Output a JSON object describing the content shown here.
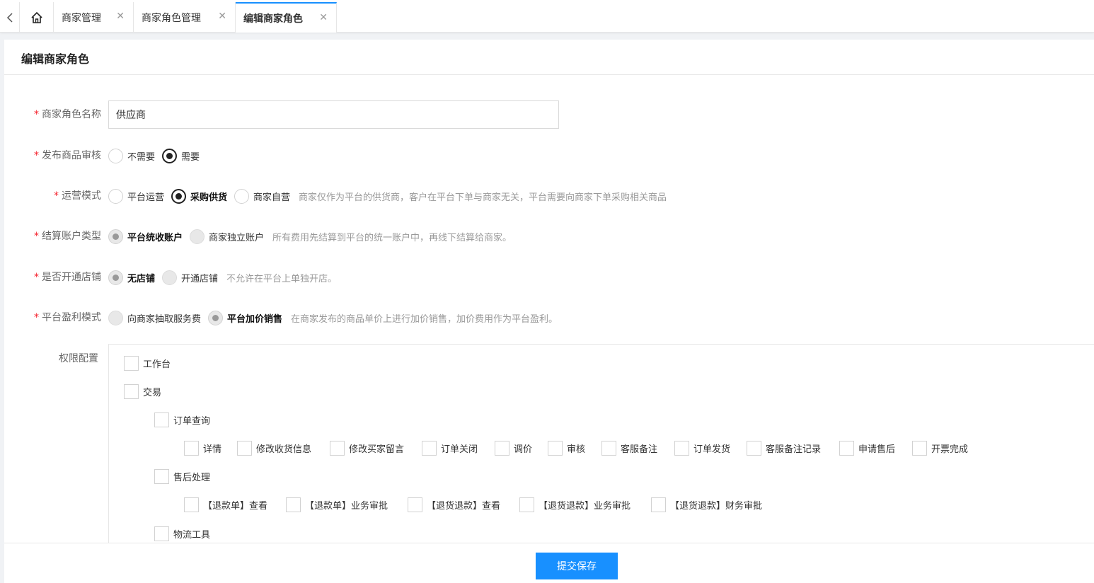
{
  "tabs": {
    "back_icon": "chevron-left-icon",
    "home_icon": "home-icon",
    "items": [
      {
        "label": "商家管理"
      },
      {
        "label": "商家角色管理"
      },
      {
        "label": "编辑商家角色"
      }
    ],
    "close_glyph": "✕"
  },
  "page": {
    "title": "编辑商家角色"
  },
  "form": {
    "required_mark": "*",
    "role_name": {
      "label": "商家角色名称",
      "value": "供应商"
    },
    "review": {
      "label": "发布商品审核",
      "options": [
        "不需要",
        "需要"
      ],
      "selected": "需要"
    },
    "operation": {
      "label": "运营模式",
      "options": [
        "平台运营",
        "采购供货",
        "商家自营"
      ],
      "selected": "采购供货",
      "hint": "商家仅作为平台的供货商，客户在平台下单与商家无关，平台需要向商家下单采购相关商品"
    },
    "settlement": {
      "label": "结算账户类型",
      "options": [
        "平台统收账户",
        "商家独立账户"
      ],
      "selected": "平台统收账户",
      "hint": "所有费用先结算到平台的统一账户中，再线下结算给商家。"
    },
    "store": {
      "label": "是否开通店铺",
      "options": [
        "无店铺",
        "开通店铺"
      ],
      "selected": "无店铺",
      "hint": "不允许在平台上单独开店。"
    },
    "profit": {
      "label": "平台盈利模式",
      "options": [
        "向商家抽取服务费",
        "平台加价销售"
      ],
      "selected": "平台加价销售",
      "hint": "在商家发布的商品单价上进行加价销售，加价费用作为平台盈利。"
    },
    "permissions": {
      "label": "权限配置",
      "workbench": "工作台",
      "trade": "交易",
      "order_query": "订单查询",
      "order_items": [
        "详情",
        "修改收货信息",
        "修改买家留言",
        "订单关闭",
        "调价",
        "审核",
        "客服备注",
        "订单发货",
        "客服备注记录",
        "申请售后",
        "开票完成"
      ],
      "after_sale": "售后处理",
      "after_sale_items": [
        "【退款单】查看",
        "【退款单】业务审批",
        "【退货退款】查看",
        "【退货退款】业务审批",
        "【退货退款】财务审批"
      ],
      "logistics": "物流工具"
    }
  },
  "footer": {
    "submit_label": "提交保存"
  }
}
